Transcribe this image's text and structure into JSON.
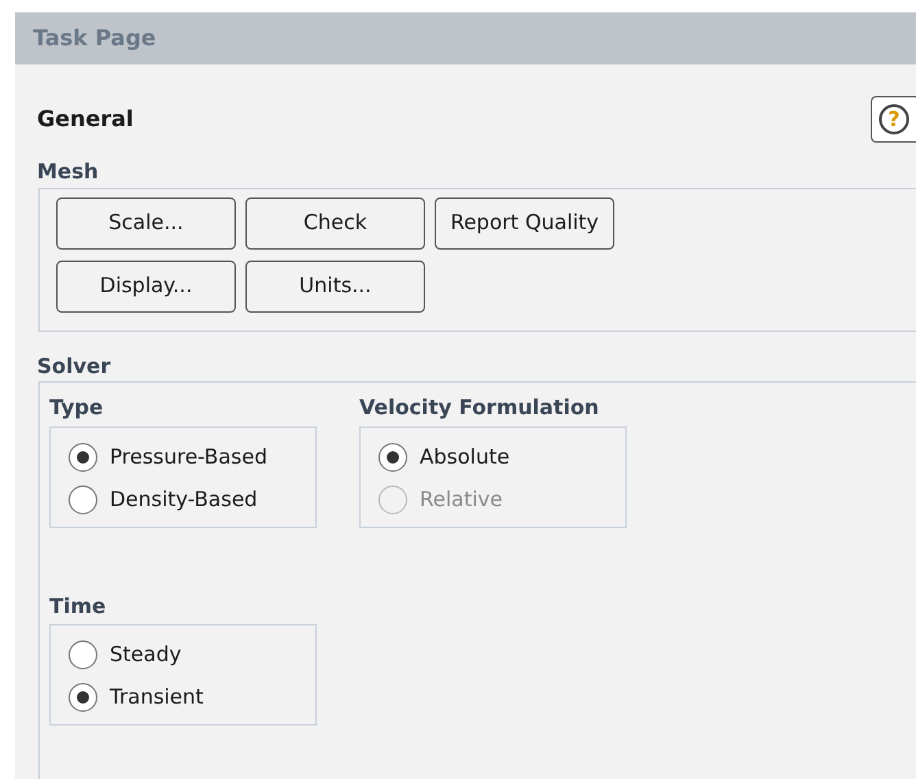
{
  "header": {
    "title": "Task Page"
  },
  "page_title": "General",
  "help_button": {
    "icon": "?"
  },
  "mesh": {
    "label": "Mesh",
    "buttons": [
      "Scale...",
      "Check",
      "Report Quality",
      "Display...",
      "Units..."
    ]
  },
  "solver": {
    "label": "Solver",
    "groups": [
      {
        "label": "Type",
        "options": [
          {
            "label": "Pressure-Based",
            "selected": true,
            "disabled": false
          },
          {
            "label": "Density-Based",
            "selected": false,
            "disabled": false
          }
        ]
      },
      {
        "label": "Velocity Formulation",
        "options": [
          {
            "label": "Absolute",
            "selected": true,
            "disabled": false
          },
          {
            "label": "Relative",
            "selected": false,
            "disabled": true
          }
        ]
      },
      {
        "label": "Time",
        "options": [
          {
            "label": "Steady",
            "selected": false,
            "disabled": false
          },
          {
            "label": "Transient",
            "selected": true,
            "disabled": false
          }
        ]
      }
    ]
  }
}
